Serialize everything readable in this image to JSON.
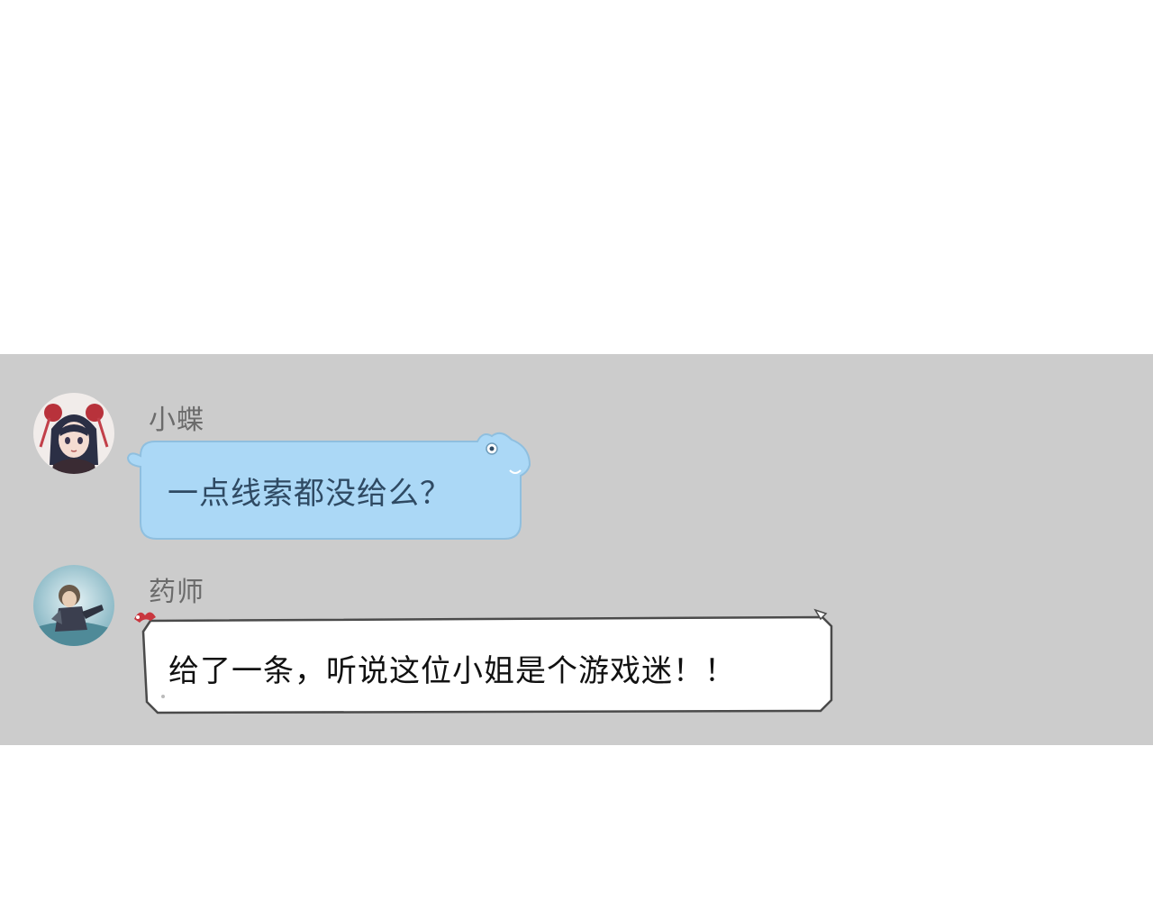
{
  "messages": [
    {
      "sender": "小蝶",
      "text": "一点线索都没给么？",
      "bubble_style": "blue",
      "bubble_color": "#abd8f6",
      "text_color": "#2f4a63"
    },
    {
      "sender": "药师",
      "text": "给了一条，听说这位小姐是个游戏迷！！",
      "bubble_style": "white",
      "bubble_color": "#ffffff",
      "text_color": "#111111"
    }
  ],
  "colors": {
    "panel_bg": "#cccccc",
    "page_bg": "#ffffff",
    "name_color": "#6b6b6b"
  }
}
